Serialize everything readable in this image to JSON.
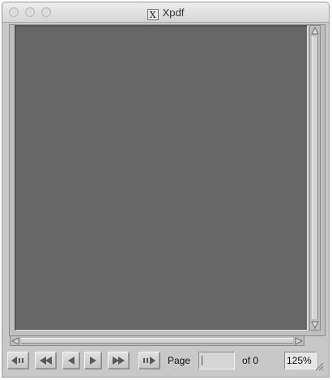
{
  "window": {
    "title": "Xpdf",
    "app_icon": "x-icon",
    "app_icon_glyph": "X"
  },
  "toolbar": {
    "page_label": "Page",
    "page_value": "",
    "of_label": "of 0",
    "zoom_value": "125%"
  },
  "colors": {
    "document_background": "#666666",
    "chrome": "#c8c8c8"
  }
}
